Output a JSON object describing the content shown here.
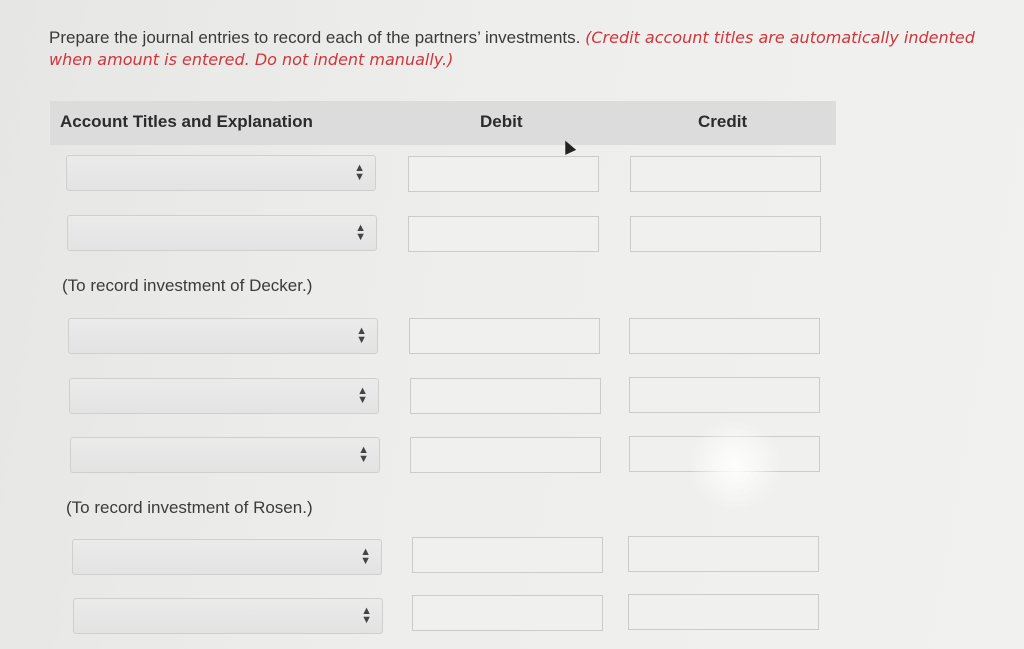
{
  "instructions": {
    "lead": "Prepare the journal entries to record each of the partners’ investments.",
    "note": "(Credit account titles are automatically indented when amount is entered. Do not indent manually.)"
  },
  "table": {
    "headers": {
      "account": "Account Titles and Explanation",
      "debit": "Debit",
      "credit": "Credit"
    },
    "entries": [
      {
        "rows": [
          {
            "account": "",
            "debit": "",
            "credit": ""
          },
          {
            "account": "",
            "debit": "",
            "credit": ""
          }
        ],
        "explanation": "(To record investment of Decker.)"
      },
      {
        "rows": [
          {
            "account": "",
            "debit": "",
            "credit": ""
          },
          {
            "account": "",
            "debit": "",
            "credit": ""
          },
          {
            "account": "",
            "debit": "",
            "credit": ""
          }
        ],
        "explanation": "(To record investment of Rosen.)"
      },
      {
        "rows": [
          {
            "account": "",
            "debit": "",
            "credit": ""
          },
          {
            "account": "",
            "debit": "",
            "credit": ""
          }
        ]
      }
    ]
  },
  "icons": {
    "select_arrow": "up-down-caret-icon",
    "cursor": "mouse-pointer-icon"
  },
  "colors": {
    "note_red": "#d1353b",
    "header_bg": "#dcdcdc"
  }
}
